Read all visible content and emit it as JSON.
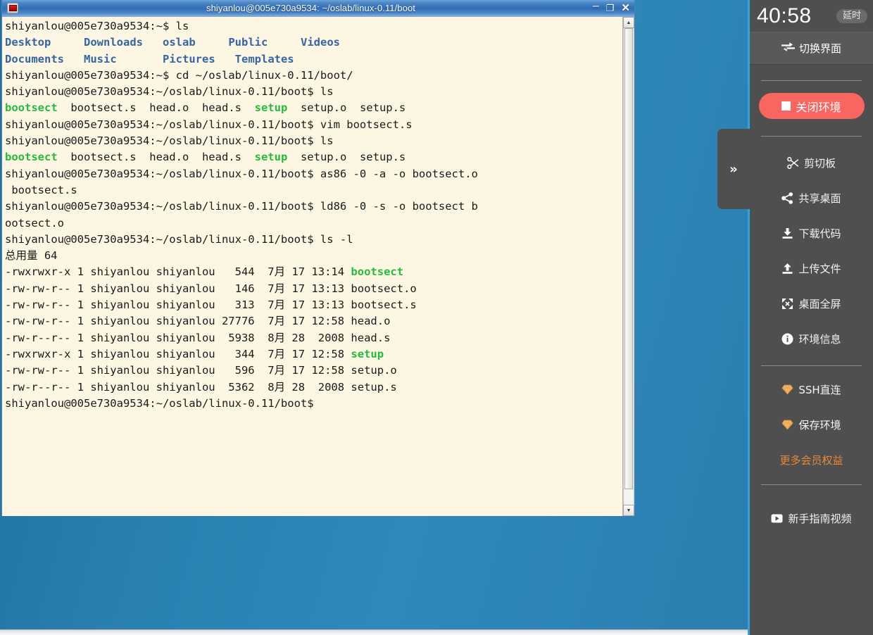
{
  "window": {
    "title": "shiyanlou@005e730a9534: ~/oslab/linux-0.11/boot",
    "icon": "terminal-icon",
    "buttons": {
      "minimize": "‒",
      "maximize": "❐",
      "close": "✕"
    }
  },
  "terminal": {
    "prompt_home": "shiyanlou@005e730a9534:~$",
    "prompt_boot": "shiyanlou@005e730a9534:~/oslab/linux-0.11/boot$",
    "lines": [
      {
        "segments": [
          {
            "t": "shiyanlou@005e730a9534:~$ ls",
            "c": ""
          }
        ]
      },
      {
        "segments": [
          {
            "t": "Desktop",
            "c": "dir"
          },
          {
            "t": "     ",
            "c": ""
          },
          {
            "t": "Downloads",
            "c": "dir"
          },
          {
            "t": "   ",
            "c": ""
          },
          {
            "t": "oslab",
            "c": "dir"
          },
          {
            "t": "     ",
            "c": ""
          },
          {
            "t": "Public",
            "c": "dir"
          },
          {
            "t": "     ",
            "c": ""
          },
          {
            "t": "Videos",
            "c": "dir"
          }
        ]
      },
      {
        "segments": [
          {
            "t": "Documents",
            "c": "dir"
          },
          {
            "t": "   ",
            "c": ""
          },
          {
            "t": "Music",
            "c": "dir"
          },
          {
            "t": "       ",
            "c": ""
          },
          {
            "t": "Pictures",
            "c": "dir"
          },
          {
            "t": "   ",
            "c": ""
          },
          {
            "t": "Templates",
            "c": "dir"
          }
        ]
      },
      {
        "segments": [
          {
            "t": "shiyanlou@005e730a9534:~$ cd ~/oslab/linux-0.11/boot/",
            "c": ""
          }
        ]
      },
      {
        "segments": [
          {
            "t": "shiyanlou@005e730a9534:~/oslab/linux-0.11/boot$ ls",
            "c": ""
          }
        ]
      },
      {
        "segments": [
          {
            "t": "bootsect",
            "c": "exe"
          },
          {
            "t": "  bootsect.s  head.o  head.s  ",
            "c": ""
          },
          {
            "t": "setup",
            "c": "exe"
          },
          {
            "t": "  setup.o  setup.s",
            "c": ""
          }
        ]
      },
      {
        "segments": [
          {
            "t": "shiyanlou@005e730a9534:~/oslab/linux-0.11/boot$ vim bootsect.s",
            "c": ""
          }
        ]
      },
      {
        "segments": [
          {
            "t": "shiyanlou@005e730a9534:~/oslab/linux-0.11/boot$ ls",
            "c": ""
          }
        ]
      },
      {
        "segments": [
          {
            "t": "bootsect",
            "c": "exe"
          },
          {
            "t": "  bootsect.s  head.o  head.s  ",
            "c": ""
          },
          {
            "t": "setup",
            "c": "exe"
          },
          {
            "t": "  setup.o  setup.s",
            "c": ""
          }
        ]
      },
      {
        "segments": [
          {
            "t": "shiyanlou@005e730a9534:~/oslab/linux-0.11/boot$ as86 -0 -a -o bootsect.o",
            "c": ""
          }
        ]
      },
      {
        "segments": [
          {
            "t": " bootsect.s",
            "c": ""
          }
        ]
      },
      {
        "segments": [
          {
            "t": "shiyanlou@005e730a9534:~/oslab/linux-0.11/boot$ ld86 -0 -s -o bootsect b",
            "c": ""
          }
        ]
      },
      {
        "segments": [
          {
            "t": "ootsect.o",
            "c": ""
          }
        ]
      },
      {
        "segments": [
          {
            "t": "shiyanlou@005e730a9534:~/oslab/linux-0.11/boot$ ls -l",
            "c": ""
          }
        ]
      },
      {
        "segments": [
          {
            "t": "总用量 64",
            "c": ""
          }
        ]
      },
      {
        "segments": [
          {
            "t": "-rwxrwxr-x 1 shiyanlou shiyanlou   544  7月 17 13:14 ",
            "c": ""
          },
          {
            "t": "bootsect",
            "c": "exe"
          }
        ]
      },
      {
        "segments": [
          {
            "t": "-rw-rw-r-- 1 shiyanlou shiyanlou   146  7月 17 13:13 bootsect.o",
            "c": ""
          }
        ]
      },
      {
        "segments": [
          {
            "t": "-rw-rw-r-- 1 shiyanlou shiyanlou   313  7月 17 13:13 bootsect.s",
            "c": ""
          }
        ]
      },
      {
        "segments": [
          {
            "t": "-rw-rw-r-- 1 shiyanlou shiyanlou 27776  7月 17 12:58 head.o",
            "c": ""
          }
        ]
      },
      {
        "segments": [
          {
            "t": "-rw-r--r-- 1 shiyanlou shiyanlou  5938  8月 28  2008 head.s",
            "c": ""
          }
        ]
      },
      {
        "segments": [
          {
            "t": "-rwxrwxr-x 1 shiyanlou shiyanlou   344  7月 17 12:58 ",
            "c": ""
          },
          {
            "t": "setup",
            "c": "exe"
          }
        ]
      },
      {
        "segments": [
          {
            "t": "-rw-rw-r-- 1 shiyanlou shiyanlou   596  7月 17 12:58 setup.o",
            "c": ""
          }
        ]
      },
      {
        "segments": [
          {
            "t": "-rw-r--r-- 1 shiyanlou shiyanlou  5362  8月 28  2008 setup.s",
            "c": ""
          }
        ]
      },
      {
        "segments": [
          {
            "t": "shiyanlou@005e730a9534:~/oslab/linux-0.11/boot$",
            "c": ""
          }
        ]
      }
    ],
    "scrollbar": {
      "up_arrow": "▲",
      "down_arrow": "▼"
    },
    "colors": {
      "background": "#fdf6e3",
      "foreground": "#1a1a1a",
      "directory": "#3465a4",
      "executable": "#25bb3c"
    }
  },
  "sidebar": {
    "clock": "40:58",
    "delay_button": "延时",
    "switch_ui": "切换界面",
    "close_env": "关闭环境",
    "handle": "»",
    "menu": [
      {
        "label": "剪切板",
        "icon": "scissors-icon"
      },
      {
        "label": "共享桌面",
        "icon": "share-icon"
      },
      {
        "label": "下载代码",
        "icon": "download-icon"
      },
      {
        "label": "上传文件",
        "icon": "upload-icon"
      },
      {
        "label": "桌面全屏",
        "icon": "fullscreen-icon"
      },
      {
        "label": "环境信息",
        "icon": "info-icon"
      }
    ],
    "member": [
      {
        "label": "SSH直连",
        "icon": "diamond-icon"
      },
      {
        "label": "保存环境",
        "icon": "diamond-icon"
      }
    ],
    "more_benefits": "更多会员权益",
    "guide_video": "新手指南视频",
    "colors": {
      "panel": "#4f4f4f",
      "accent_blue": "#35a3d6",
      "close_red": "#f9655f",
      "orange": "#e8883a",
      "gold": "#e8a33d"
    }
  }
}
